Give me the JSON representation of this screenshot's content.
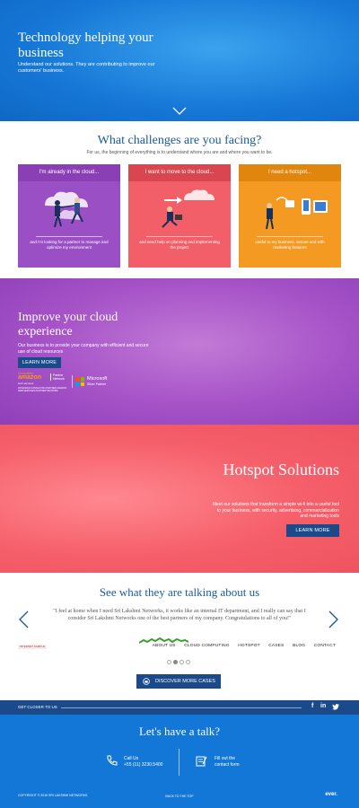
{
  "colors": {
    "hero_blue": "#1677d6",
    "heading_blue": "#1a5aa0",
    "button_navy": "#1a4a8a",
    "card_purple": "#9b4fc4",
    "card_red": "#f25f68",
    "card_orange": "#f49a22"
  },
  "hero": {
    "title": "Technology helping your business",
    "subtitle": "Understand our solutions. They are contributing to improve our customers' business.",
    "scroll_icon": "chevron-down-icon"
  },
  "challenges": {
    "title": "What challenges are you facing?",
    "subtitle": "For us, the beginning of everything is to understand where you are and where you want to be.",
    "cards": [
      {
        "header": "I'm already in the cloud...",
        "text": "and I'm looking for a partner to manage and optimize my environment",
        "icon": "people-on-cloud-icon"
      },
      {
        "header": "I want to move to the cloud...",
        "text": "and need help on planning and implementing the project",
        "icon": "person-to-cloud-icon"
      },
      {
        "header": "I need a hotspot...",
        "text": "useful to my business, secure and with marketing features",
        "icon": "hotspot-devices-icon"
      }
    ]
  },
  "cloud": {
    "title": "Improve your cloud experience",
    "text": "Our business is to provide your company with efficient and secure use of cloud resources",
    "button": "LEARN MORE",
    "aws": {
      "line1": "Consulting",
      "line2": "amazon",
      "line3": "web services",
      "line4": "Partner\nNetwork",
      "line5": "ADVANCED CONSULTING PARTNER AMAZON WEB SERVICES PARTNER NETWORK"
    },
    "microsoft": {
      "name": "Microsoft",
      "tag": "Silver Partner"
    }
  },
  "hotspot": {
    "title": "Hotspot Solutions",
    "text": "Meet our solutions that transform a simple wi-fi into a useful tool to your business, with security, advertising, commercialization and marketing tools",
    "button": "LEARN MORE"
  },
  "testimonials": {
    "title": "See what they are talking about us",
    "quote": "\"I feel at home when I need Sri Lakshmi Networks, it works like an internal IT department, and I really can say that I consider Sri Lakshmi Networks one of the best partners of my company. Congratulations to all of you!\"",
    "client_logo": "INTERNET SAMPLE",
    "nav": [
      "ABOUT US",
      "CLOUD COMPUTING",
      "HOTSPOT",
      "CASES",
      "BLOG",
      "CONTACT"
    ],
    "slide_count": 4,
    "active_slide": 2,
    "discover_button": "DISCOVER MORE CASES"
  },
  "closer": {
    "label": "GET CLOSER TO US",
    "social": [
      "f",
      "in",
      "t"
    ]
  },
  "footer": {
    "title": "Let's have a talk?",
    "call_label": "Call Us",
    "call_number": "+55 (11) 3230.5400",
    "form_line1": "Fill out the",
    "form_line2": "contact form",
    "copyright": "COPYRIGHT © 2016 SRI LAKSHMI NETWORKS",
    "back_to_top": "BACK TO THE TOP",
    "brand": "ever."
  }
}
